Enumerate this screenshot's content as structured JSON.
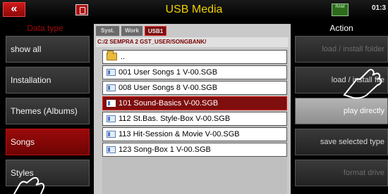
{
  "header": {
    "back_label": "«",
    "title": "USB Media",
    "clock": "01:3",
    "chip_label": "RAM"
  },
  "left_panel": {
    "title": "Data type",
    "items": [
      {
        "label": "show all",
        "active": false
      },
      {
        "label": "Installation",
        "active": false
      },
      {
        "label": "Themes (Albums)",
        "active": false
      },
      {
        "label": "Songs",
        "active": true
      },
      {
        "label": "Styles",
        "active": false
      }
    ]
  },
  "center": {
    "tabs": [
      {
        "label": "Syst."
      },
      {
        "label": "Work"
      },
      {
        "label": "USB1",
        "active": true
      }
    ],
    "path": "C:/2 SEMPRA 2 GST_USER/SONGBANK/",
    "parent_folder_label": "..",
    "files": [
      {
        "label": "001 User Songs 1 V-00.SGB",
        "selected": false
      },
      {
        "label": "008 User Songs 8 V-00.SGB",
        "selected": false
      },
      {
        "label": "101 Sound-Basics V-00.SGB",
        "selected": true
      },
      {
        "label": "112 St.Bas. Style-Box V-00.SGB",
        "selected": false
      },
      {
        "label": "113 Hit-Session & Movie V-00.SGB",
        "selected": false
      },
      {
        "label": "123 Song-Box 1 V-00.SGB",
        "selected": false
      }
    ]
  },
  "right_panel": {
    "title": "Action",
    "buttons": [
      {
        "label": "load / install folder",
        "state": "disabled"
      },
      {
        "label": "load / install file",
        "state": "normal"
      },
      {
        "label": "play directly",
        "state": "highlight"
      },
      {
        "label": "save selected type",
        "state": "normal"
      },
      {
        "label": "format drive",
        "state": "disabled"
      }
    ]
  },
  "colors": {
    "accent_red": "#7f0e0e",
    "title_yellow": "#f0d000"
  },
  "icons": [
    "back-icon",
    "usb-disk-icon",
    "memory-chip-icon",
    "folder-icon",
    "song-file-icon",
    "hand-cursor-icon"
  ]
}
